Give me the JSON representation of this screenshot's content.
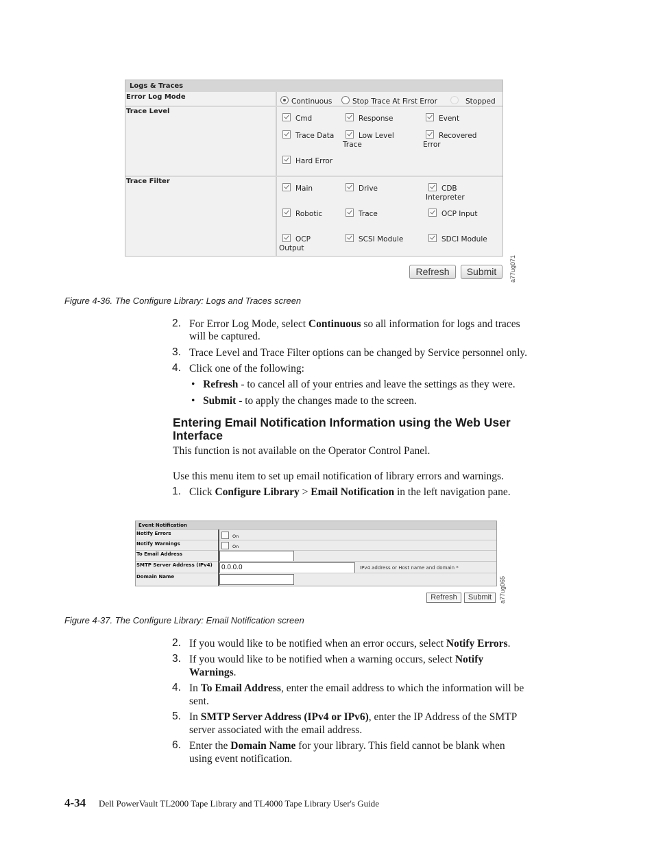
{
  "figure1": {
    "panel_title": "Logs & Traces",
    "error_log_mode": {
      "label": "Error Log Mode",
      "options": [
        {
          "label": "Continuous",
          "selected": true,
          "enabled": true
        },
        {
          "label": "Stop Trace At First Error",
          "selected": false,
          "enabled": true
        },
        {
          "label": "Stopped",
          "selected": false,
          "enabled": false
        }
      ]
    },
    "trace_level": {
      "label": "Trace Level",
      "options": [
        {
          "label": "Cmd",
          "checked": true
        },
        {
          "label": "Response",
          "checked": true
        },
        {
          "label": "Event",
          "checked": true
        },
        {
          "label": "Trace Data",
          "checked": true
        },
        {
          "label": "Low Level",
          "label2": "Trace",
          "checked": true
        },
        {
          "label": "Recovered",
          "label2": "Error",
          "checked": true
        },
        {
          "label": "Hard Error",
          "checked": true
        }
      ]
    },
    "trace_filter": {
      "label": "Trace Filter",
      "options": [
        {
          "label": "Main",
          "checked": true
        },
        {
          "label": "Drive",
          "checked": true
        },
        {
          "label": "CDB",
          "label2": "Interpreter",
          "checked": true
        },
        {
          "label": "Robotic",
          "checked": true
        },
        {
          "label": "Trace",
          "checked": true
        },
        {
          "label": "OCP Input",
          "checked": true
        },
        {
          "label": "OCP",
          "label2": "Output",
          "checked": true
        },
        {
          "label": "SCSI Module",
          "checked": true
        },
        {
          "label": "SDCI Module",
          "checked": true
        }
      ]
    },
    "buttons": {
      "refresh": "Refresh",
      "submit": "Submit"
    },
    "figure_id": "a77ug071",
    "caption": "Figure 4-36. The Configure Library: Logs and Traces screen"
  },
  "steps1": [
    {
      "num": "2.",
      "pre": "For Error Log Mode, select ",
      "bold": "Continuous",
      "post": " so all information for logs and traces",
      "line2": "will be captured."
    },
    {
      "num": "3.",
      "text": "Trace Level and Trace Filter options can be changed by Service personnel only."
    },
    {
      "num": "4.",
      "text": "Click one of the following:"
    }
  ],
  "bullets": [
    {
      "bold": "Refresh",
      "text": " - to cancel all of your entries and leave the settings as they were."
    },
    {
      "bold": "Submit",
      "text": " - to apply the changes made to the screen."
    }
  ],
  "section": {
    "heading_line1": "Entering Email Notification Information using the Web User",
    "heading_line2": "Interface",
    "intro": "This function is not available on the Operator Control Panel.",
    "usage": "Use this menu item to set up email notification of library errors and warnings.",
    "step1": {
      "num": "1.",
      "pre": "Click ",
      "bold1": "Configure Library",
      "sep": " > ",
      "bold2": "Email Notification",
      "post": " in the left navigation pane."
    }
  },
  "figure2": {
    "panel_title": "Event Notification",
    "rows": [
      {
        "label": "Notify Errors",
        "checkbox_label": "On",
        "checked": false
      },
      {
        "label": "Notify Warnings",
        "checkbox_label": "On",
        "checked": false
      },
      {
        "label": "To Email Address",
        "value": ""
      },
      {
        "label": "SMTP Server Address (IPv4)",
        "value": "0.0.0.0",
        "hint": "IPv4 address or Host name and domain *"
      },
      {
        "label": "Domain Name",
        "value": ""
      }
    ],
    "buttons": {
      "refresh": "Refresh",
      "submit": "Submit"
    },
    "figure_id": "a77ug065",
    "caption": "Figure 4-37. The Configure Library: Email Notification screen"
  },
  "steps2": [
    {
      "num": "2.",
      "pre": "If you would like to be notified when an error occurs, select ",
      "bold": "Notify Errors",
      "post": "."
    },
    {
      "num": "3.",
      "pre": "If you would like to be notified when a warning occurs, select ",
      "bold": "Notify",
      "post": "",
      "line2_bold": "Warnings",
      "line2": "."
    },
    {
      "num": "4.",
      "pre": "In ",
      "bold": "To Email Address",
      "post": ", enter the email address to which the information will be",
      "line2": "sent."
    },
    {
      "num": "5.",
      "pre": "In ",
      "bold": "SMTP Server Address (IPv4 or IPv6)",
      "post": ", enter the IP Address of the SMTP",
      "line2": "server associated with the email address."
    },
    {
      "num": "6.",
      "pre": "Enter the ",
      "bold": "Domain Name",
      "post": " for your library. This field cannot be blank when",
      "line2": "using event notification."
    }
  ],
  "footer": {
    "page_number": "4-34",
    "title": "Dell PowerVault TL2000 Tape Library and TL4000 Tape Library User's Guide"
  }
}
